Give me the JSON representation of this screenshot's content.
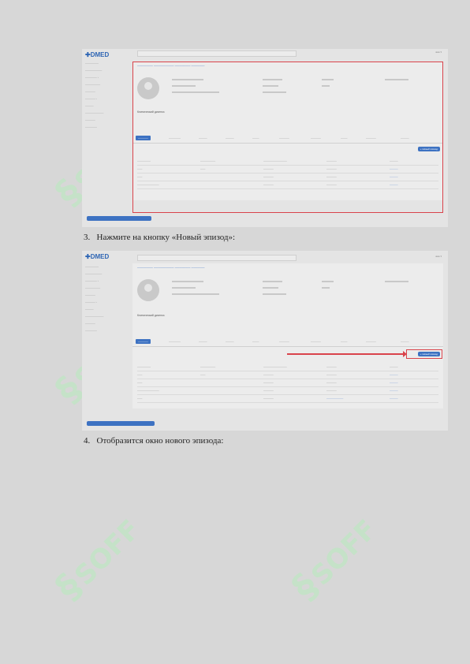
{
  "steps": [
    {
      "num": "3.",
      "text": "Нажмите на кнопку «Новый эпизод»:"
    },
    {
      "num": "4.",
      "text": "Отобразится окно нового эпизода:"
    }
  ],
  "watermark": {
    "text": "SOFF",
    "glyph": "§",
    "color": "#bfe6c3"
  },
  "app": {
    "logo": "DMED",
    "diagnosis_label": "Клинический диагноз",
    "new_episode_button": "+ Новый эпизод",
    "accent_color": "#3d72c2",
    "highlight_color": "#d9434b"
  }
}
